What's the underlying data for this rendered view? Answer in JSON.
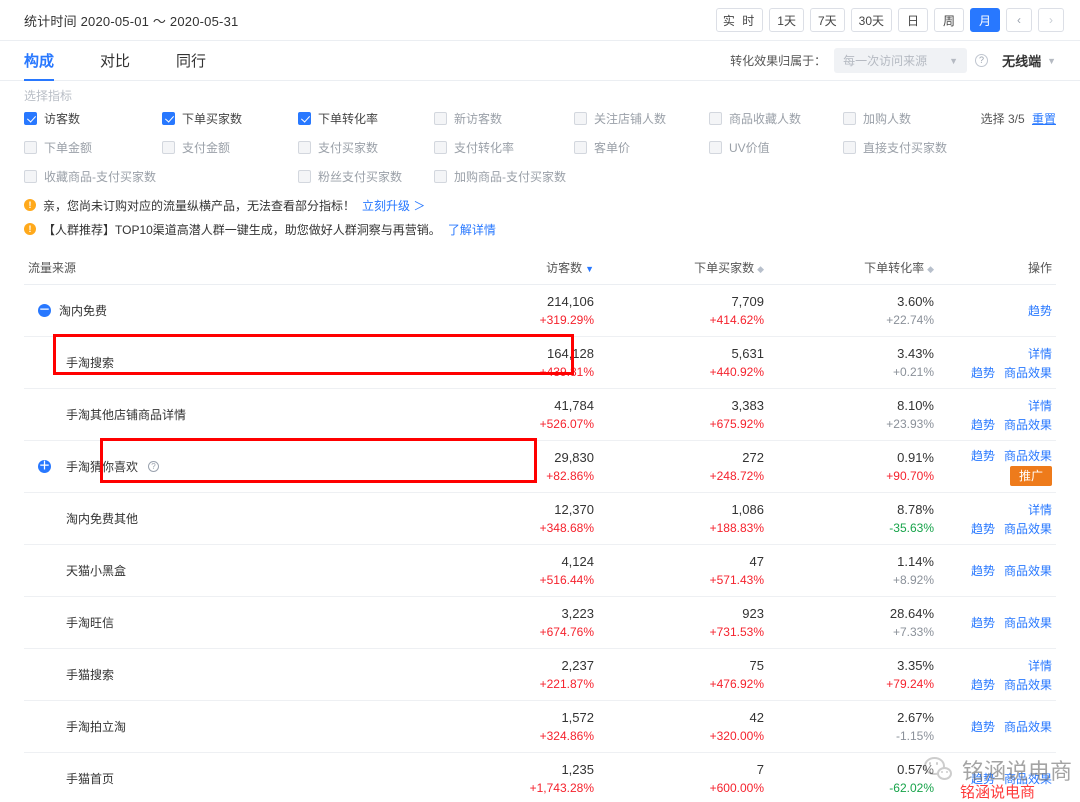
{
  "topbar": {
    "stat_time": "统计时间 2020-05-01 ～ 2020-05-31",
    "date_buttons": [
      {
        "label": "实 时",
        "active": false
      },
      {
        "label": "1天",
        "active": false
      },
      {
        "label": "7天",
        "active": false
      },
      {
        "label": "30天",
        "active": false
      },
      {
        "label": "日",
        "active": false
      },
      {
        "label": "周",
        "active": false
      },
      {
        "label": "月",
        "active": true
      }
    ],
    "prev_arrow": "‹",
    "next_arrow": "›"
  },
  "tabs": [
    {
      "label": "构成",
      "active": true
    },
    {
      "label": "对比",
      "active": false
    },
    {
      "label": "同行",
      "active": false
    }
  ],
  "tab_right": {
    "attribution_label": "转化效果归属于：",
    "attribution_value": "每一次访问来源",
    "terminal_value": "无线端"
  },
  "picker": {
    "title": "选择指标",
    "metrics": [
      {
        "label": "访客数",
        "checked": true,
        "disabled": false
      },
      {
        "label": "下单买家数",
        "checked": true,
        "disabled": false
      },
      {
        "label": "下单转化率",
        "checked": true,
        "disabled": false
      },
      {
        "label": "新访客数",
        "checked": false,
        "disabled": true
      },
      {
        "label": "关注店铺人数",
        "checked": false,
        "disabled": true
      },
      {
        "label": "商品收藏人数",
        "checked": false,
        "disabled": true
      },
      {
        "label": "加购人数",
        "checked": false,
        "disabled": true
      },
      {
        "label": "下单金额",
        "checked": false,
        "disabled": true
      },
      {
        "label": "支付金额",
        "checked": false,
        "disabled": true
      },
      {
        "label": "支付买家数",
        "checked": false,
        "disabled": true
      },
      {
        "label": "支付转化率",
        "checked": false,
        "disabled": true
      },
      {
        "label": "客单价",
        "checked": false,
        "disabled": true
      },
      {
        "label": "UV价值",
        "checked": false,
        "disabled": true
      },
      {
        "label": "直接支付买家数",
        "checked": false,
        "disabled": true
      },
      {
        "label": "收藏商品-支付买家数",
        "checked": false,
        "disabled": true
      },
      {
        "label": "粉丝支付买家数",
        "checked": false,
        "disabled": true
      },
      {
        "label": "加购商品-支付买家数",
        "checked": false,
        "disabled": true
      }
    ],
    "select_count_prefix": "选择",
    "select_count_value": "3/5",
    "reset_label": "重置"
  },
  "notices": [
    {
      "icon": "!",
      "text": "亲，您尚未订购对应的流量纵横产品，无法查看部分指标！",
      "link": "立刻升级 ＞"
    },
    {
      "icon": "!",
      "text": "【人群推荐】TOP10渠道高潜人群一键生成，助您做好人群洞察与再营销。",
      "link": "了解详情"
    }
  ],
  "table": {
    "headers": {
      "source": "流量来源",
      "visitors": "访客数",
      "buyers": "下单买家数",
      "conv": "下单转化率",
      "ops": "操作"
    },
    "rows": [
      {
        "name": "淘内免费",
        "level": 0,
        "toggle": "－",
        "tip": false,
        "visitors": {
          "value": "214,106",
          "delta": "+319.29%",
          "dir": "up"
        },
        "buyers": {
          "value": "7,709",
          "delta": "+414.62%",
          "dir": "up"
        },
        "conv": {
          "value": "3.60%",
          "delta": "+22.74%",
          "dir": "flat"
        },
        "ops_top": [],
        "ops_bottom": [
          "趋势"
        ],
        "promo": false
      },
      {
        "name": "手淘搜索",
        "level": 1,
        "toggle": null,
        "tip": false,
        "visitors": {
          "value": "164,128",
          "delta": "+439.81%",
          "dir": "up"
        },
        "buyers": {
          "value": "5,631",
          "delta": "+440.92%",
          "dir": "up"
        },
        "conv": {
          "value": "3.43%",
          "delta": "+0.21%",
          "dir": "flat"
        },
        "ops_top": [
          "详情"
        ],
        "ops_bottom": [
          "趋势",
          "商品效果"
        ],
        "promo": false
      },
      {
        "name": "手淘其他店铺商品详情",
        "level": 1,
        "toggle": null,
        "tip": false,
        "visitors": {
          "value": "41,784",
          "delta": "+526.07%",
          "dir": "up"
        },
        "buyers": {
          "value": "3,383",
          "delta": "+675.92%",
          "dir": "up"
        },
        "conv": {
          "value": "8.10%",
          "delta": "+23.93%",
          "dir": "flat"
        },
        "ops_top": [
          "详情"
        ],
        "ops_bottom": [
          "趋势",
          "商品效果"
        ],
        "promo": false
      },
      {
        "name": "手淘猜你喜欢",
        "level": 1,
        "toggle": "＋",
        "tip": true,
        "visitors": {
          "value": "29,830",
          "delta": "+82.86%",
          "dir": "up"
        },
        "buyers": {
          "value": "272",
          "delta": "+248.72%",
          "dir": "up"
        },
        "conv": {
          "value": "0.91%",
          "delta": "+90.70%",
          "dir": "up"
        },
        "ops_top": [
          "趋势",
          "商品效果"
        ],
        "ops_bottom": [],
        "promo": true,
        "promo_label": "推广"
      },
      {
        "name": "淘内免费其他",
        "level": 1,
        "toggle": null,
        "tip": false,
        "visitors": {
          "value": "12,370",
          "delta": "+348.68%",
          "dir": "up"
        },
        "buyers": {
          "value": "1,086",
          "delta": "+188.83%",
          "dir": "up"
        },
        "conv": {
          "value": "8.78%",
          "delta": "-35.63%",
          "dir": "down"
        },
        "ops_top": [
          "详情"
        ],
        "ops_bottom": [
          "趋势",
          "商品效果"
        ],
        "promo": false
      },
      {
        "name": "天猫小黑盒",
        "level": 1,
        "toggle": null,
        "tip": false,
        "visitors": {
          "value": "4,124",
          "delta": "+516.44%",
          "dir": "up"
        },
        "buyers": {
          "value": "47",
          "delta": "+571.43%",
          "dir": "up"
        },
        "conv": {
          "value": "1.14%",
          "delta": "+8.92%",
          "dir": "flat"
        },
        "ops_top": [],
        "ops_bottom": [
          "趋势",
          "商品效果"
        ],
        "promo": false
      },
      {
        "name": "手淘旺信",
        "level": 1,
        "toggle": null,
        "tip": false,
        "visitors": {
          "value": "3,223",
          "delta": "+674.76%",
          "dir": "up"
        },
        "buyers": {
          "value": "923",
          "delta": "+731.53%",
          "dir": "up"
        },
        "conv": {
          "value": "28.64%",
          "delta": "+7.33%",
          "dir": "flat"
        },
        "ops_top": [],
        "ops_bottom": [
          "趋势",
          "商品效果"
        ],
        "promo": false
      },
      {
        "name": "手猫搜索",
        "level": 1,
        "toggle": null,
        "tip": false,
        "visitors": {
          "value": "2,237",
          "delta": "+221.87%",
          "dir": "up"
        },
        "buyers": {
          "value": "75",
          "delta": "+476.92%",
          "dir": "up"
        },
        "conv": {
          "value": "3.35%",
          "delta": "+79.24%",
          "dir": "up"
        },
        "ops_top": [
          "详情"
        ],
        "ops_bottom": [
          "趋势",
          "商品效果"
        ],
        "promo": false
      },
      {
        "name": "手淘拍立淘",
        "level": 1,
        "toggle": null,
        "tip": false,
        "visitors": {
          "value": "1,572",
          "delta": "+324.86%",
          "dir": "up"
        },
        "buyers": {
          "value": "42",
          "delta": "+320.00%",
          "dir": "up"
        },
        "conv": {
          "value": "2.67%",
          "delta": "-1.15%",
          "dir": "flat"
        },
        "ops_top": [],
        "ops_bottom": [
          "趋势",
          "商品效果"
        ],
        "promo": false
      },
      {
        "name": "手猫首页",
        "level": 1,
        "toggle": null,
        "tip": false,
        "visitors": {
          "value": "1,235",
          "delta": "+1,743.28%",
          "dir": "up"
        },
        "buyers": {
          "value": "7",
          "delta": "+600.00%",
          "dir": "up"
        },
        "conv": {
          "value": "0.57%",
          "delta": "-62.02%",
          "dir": "down"
        },
        "ops_top": [],
        "ops_bottom": [
          "趋势",
          "商品效果"
        ],
        "promo": false
      }
    ]
  },
  "watermark": {
    "main": "铭涵说电商",
    "sub": "铭涵说电商"
  },
  "colors": {
    "accent": "#2878ff",
    "up": "#f5222d",
    "down": "#17a34a",
    "flat": "#8a9099",
    "promo": "#ee7b1b",
    "highlight": "#ff0000"
  }
}
